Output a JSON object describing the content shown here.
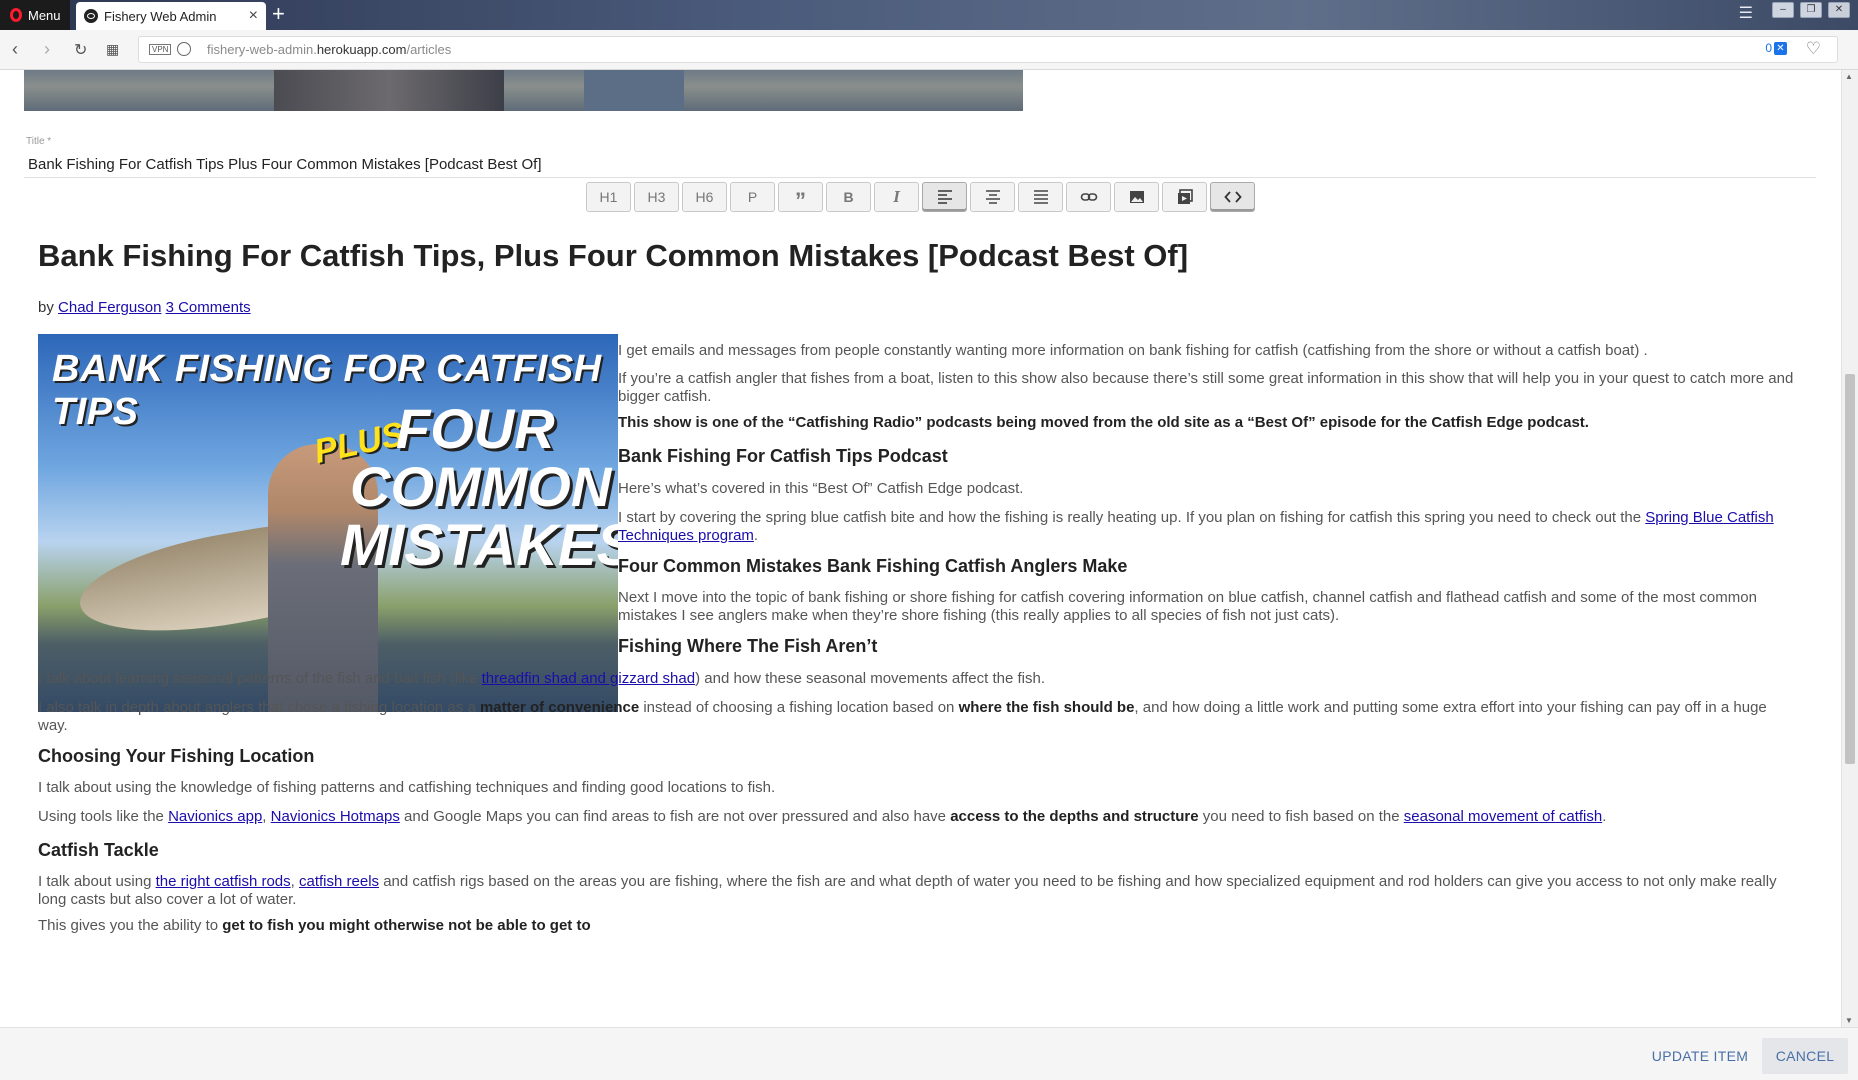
{
  "browser": {
    "menu_label": "Menu",
    "tab_title": "Fishery Web Admin",
    "url_prefix": "fishery-web-admin.",
    "url_host": "herokuapp.com",
    "url_path": "/articles",
    "vpn_label": "VPN",
    "tracker_count": "0"
  },
  "form": {
    "title_label": "Title *",
    "title_value": "Bank Fishing For Catfish Tips Plus Four Common Mistakes [Podcast Best Of]"
  },
  "toolbar": {
    "h1": "H1",
    "h3": "H3",
    "h6": "H6",
    "p": "P",
    "quote": "”",
    "bold": "B",
    "italic": "I"
  },
  "article": {
    "title": "Bank Fishing For Catfish Tips, Plus Four Common Mistakes [Podcast Best Of]",
    "by": "by",
    "author": "Chad Ferguson",
    "comments": "3 Comments",
    "image_text": {
      "line1": "BANK FISHING FOR CATFISH TIPS",
      "plus": "PLUS",
      "line2": "FOUR",
      "line3": "COMMON",
      "line4": "MISTAKES"
    },
    "p1": "I get emails and messages from people constantly wanting more information on bank fishing for catfish (catfishing from the shore or without a catfish boat) .",
    "p2": "If you’re a catfish angler that fishes from a boat, listen to this show also because there’s still some great information in this show that will help you in your quest to catch more and bigger catfish.",
    "p3": "This show is one of the “Catfishing Radio” podcasts being moved from the old site as a “Best Of” episode for the Catfish Edge podcast.",
    "h_podcast": "Bank Fishing For Catfish Tips Podcast",
    "p4": "Here’s what’s covered in this “Best Of” Catfish Edge podcast.",
    "p5_a": "I start by covering the spring blue catfish bite and how the fishing is really heating up. If you plan on fishing for catfish this spring you need to check out the ",
    "p5_link": "Spring Blue Catfish Techniques program",
    "p5_b": ".",
    "h_mistakes": "Four Common Mistakes Bank Fishing Catfish Anglers Make",
    "p6": "Next I move into the topic of bank fishing or shore fishing for catfish covering information on blue catfish, channel catfish and flathead catfish and some of the most common mistakes I see anglers make when they’re shore fishing (this really applies to all species of fish not just cats).",
    "h_where": "Fishing Where The Fish Aren’t",
    "p7_a": "I talk about learning seasonal patterns of the fish and bait fish (like ",
    "p7_link": "threadfin shad and gizzard shad",
    "p7_b": ") and how these seasonal movements affect the fish.",
    "p8_a": "I also talk in depth about anglers that chose a fishing location as a ",
    "p8_b1": "matter of convenience",
    "p8_c": " instead of choosing a fishing location based on ",
    "p8_b2": "where the fish should be",
    "p8_d": ", and how doing a little work and putting some extra effort into your fishing can pay off in a huge way.",
    "h_location": "Choosing Your Fishing Location",
    "p9": "I talk about using the knowledge of fishing patterns and catfishing techniques and finding good locations to fish.",
    "p10_a": "Using tools like the ",
    "p10_l1": "Navionics app",
    "p10_sep": ", ",
    "p10_l2": "Navionics Hotmaps",
    "p10_b": " and Google Maps you can find areas to fish are not over pressured and also have ",
    "p10_bold": "access to the depths and structure",
    "p10_c": " you need to fish based on the ",
    "p10_l3": "seasonal movement of catfish",
    "p10_d": ".",
    "h_tackle": "Catfish Tackle",
    "p11_a": "I talk about using ",
    "p11_l1": "the right catfish rods",
    "p11_sep": ", ",
    "p11_l2": "catfish reels",
    "p11_b": " and catfish rigs based on the areas you are fishing, where the fish are and what depth of water you need to be fishing and how specialized equipment and rod holders can give you access to not only make really long casts but also cover a lot of water.",
    "p12_a": "This gives you the ability to ",
    "p12_bold": "get to fish you might otherwise not be able to get to"
  },
  "actions": {
    "update": "UPDATE ITEM",
    "cancel": "CANCEL"
  },
  "colors": {
    "link": "#1a0dab",
    "action_text": "#4a6fa5",
    "opera_red": "#ff1b2d"
  }
}
